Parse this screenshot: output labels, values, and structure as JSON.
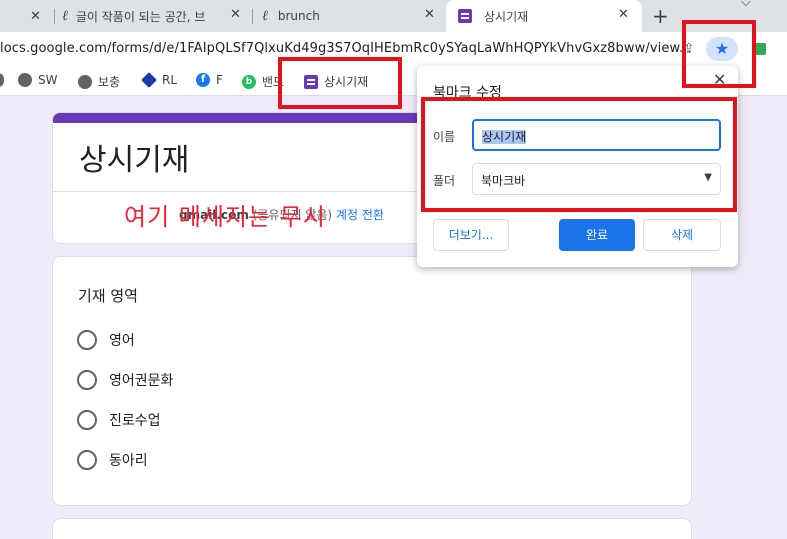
{
  "tabs": [
    {
      "title": "글이 작품이 되는 공간, 브",
      "icon": "brunch-pen-icon",
      "active": false
    },
    {
      "title": "brunch",
      "icon": "brunch-pen-icon",
      "active": false
    },
    {
      "title": "상시기재",
      "icon": "google-forms-icon",
      "active": true
    }
  ],
  "tab_close_glyph": "✕",
  "new_tab_glyph": "+",
  "tab_menu_glyph": "⌵",
  "address": {
    "url": "locs.google.com/forms/d/e/1FAIpQLSf7QlxuKd49g3S7OqIHEbmRc0ySYaqLaWhHQPYkVhvGxz8bww/view...",
    "share_glyph": "⇪",
    "star_glyph": "★"
  },
  "bookmarks": [
    {
      "label": "SW",
      "icon": "globe-icon"
    },
    {
      "label": "보충",
      "icon": "globe-icon"
    },
    {
      "label": "RL",
      "icon": "cube-icon"
    },
    {
      "label": "F",
      "icon": "facebook-icon"
    },
    {
      "label": "밴드",
      "icon": "band-icon"
    },
    {
      "label": "상시기재",
      "icon": "google-forms-icon"
    }
  ],
  "form": {
    "title": "상시기재",
    "account_email": "gmail.com",
    "account_note": "(공유되지 않음)",
    "switch_account": "계정 전환",
    "annotation": "여기 메세지는 무시"
  },
  "question": {
    "title": "기재 영역",
    "options": [
      "영어",
      "영어권문화",
      "진로수업",
      "동아리"
    ]
  },
  "popup": {
    "title": "북마크 수정",
    "close_glyph": "✕",
    "name_label": "이름",
    "name_value": "상시기재",
    "folder_label": "폴더",
    "folder_value": "북마크바",
    "caret": "▼",
    "more_button": "더보기...",
    "done_button": "완료",
    "delete_button": "삭제"
  },
  "colors": {
    "form_accent": "#673ab7",
    "highlight": "#e3131e",
    "primary_button": "#1a73e8"
  }
}
